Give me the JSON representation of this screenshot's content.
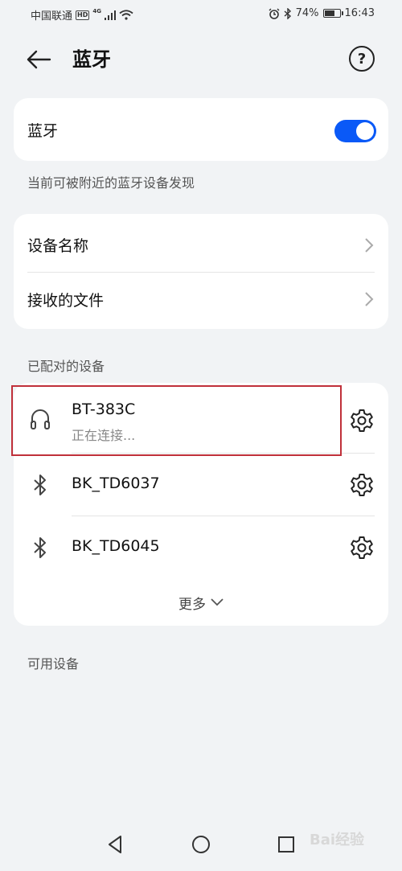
{
  "status_bar": {
    "carrier": "中国联通",
    "hd": "HD",
    "network": "4G",
    "battery_percent": "74%",
    "battery_level": 0.74,
    "time": "16:43"
  },
  "header": {
    "title": "蓝牙"
  },
  "bluetooth_toggle": {
    "label": "蓝牙",
    "on": true
  },
  "discoverable_hint": "当前可被附近的蓝牙设备发现",
  "settings": {
    "device_name_label": "设备名称",
    "received_files_label": "接收的文件"
  },
  "paired_section": {
    "title": "已配对的设备",
    "devices": [
      {
        "name": "BT-383C",
        "status": "正在连接...",
        "icon": "headphones-icon"
      },
      {
        "name": "BK_TD6037",
        "status": "",
        "icon": "bluetooth-icon"
      },
      {
        "name": "BK_TD6045",
        "status": "",
        "icon": "bluetooth-icon"
      }
    ],
    "more_label": "更多"
  },
  "available_section": {
    "title": "可用设备"
  },
  "watermark": "Bai经验",
  "colors": {
    "accent": "#0a59f7",
    "background": "#f1f3f5",
    "card": "#ffffff",
    "highlight": "#c0303a"
  }
}
